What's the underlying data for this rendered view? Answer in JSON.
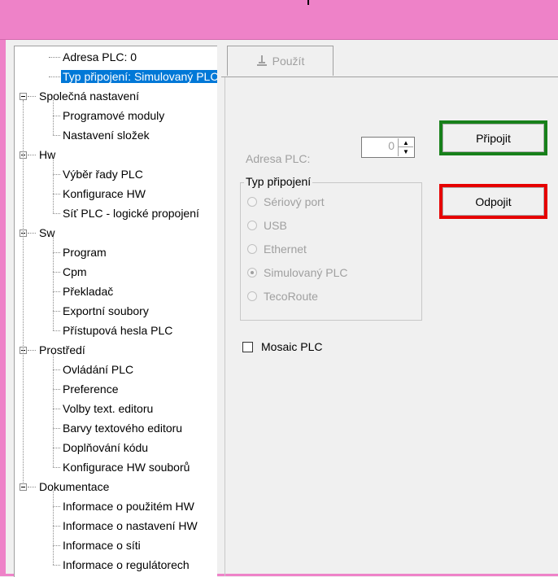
{
  "tree": {
    "items": [
      {
        "label": "Adresa PLC: 0",
        "level": 1,
        "selected": false
      },
      {
        "label": "Typ připojení: Simulovaný PLC",
        "level": 1,
        "selected": true
      },
      {
        "label": "Společná nastavení",
        "level": 0,
        "expanded": true
      },
      {
        "label": "Programové moduly",
        "level": 1
      },
      {
        "label": "Nastavení složek",
        "level": 1
      },
      {
        "label": "Hw",
        "level": 0,
        "expanded": true
      },
      {
        "label": "Výběr řady PLC",
        "level": 1
      },
      {
        "label": "Konfigurace HW",
        "level": 1
      },
      {
        "label": "Síť PLC - logické propojení",
        "level": 1
      },
      {
        "label": "Sw",
        "level": 0,
        "expanded": true
      },
      {
        "label": "Program",
        "level": 1
      },
      {
        "label": "Cpm",
        "level": 1
      },
      {
        "label": "Překladač",
        "level": 1
      },
      {
        "label": "Exportní soubory",
        "level": 1
      },
      {
        "label": "Přístupová hesla PLC",
        "level": 1
      },
      {
        "label": "Prostředí",
        "level": 0,
        "expanded": true
      },
      {
        "label": "Ovládání PLC",
        "level": 1
      },
      {
        "label": "Preference",
        "level": 1
      },
      {
        "label": "Volby text. editoru",
        "level": 1
      },
      {
        "label": "Barvy textového editoru",
        "level": 1
      },
      {
        "label": "Doplňování kódu",
        "level": 1
      },
      {
        "label": "Konfigurace HW souborů",
        "level": 1
      },
      {
        "label": "Dokumentace",
        "level": 0,
        "expanded": true
      },
      {
        "label": "Informace o použitém HW",
        "level": 1
      },
      {
        "label": "Informace o nastavení HW",
        "level": 1
      },
      {
        "label": "Informace o síti",
        "level": 1
      },
      {
        "label": "Informace o regulátorech",
        "level": 1
      }
    ]
  },
  "toolbar": {
    "apply_label": "Použít",
    "apply_icon": "apply-icon"
  },
  "form": {
    "address_label": "Adresa PLC:",
    "address_value": "0",
    "connection_group_label": "Typ připojení",
    "connection_options": [
      {
        "label": "Sériový port",
        "selected": false
      },
      {
        "label": "USB",
        "selected": false
      },
      {
        "label": "Ethernet",
        "selected": false
      },
      {
        "label": "Simulovaný PLC",
        "selected": true
      },
      {
        "label": "TecoRoute",
        "selected": false
      }
    ],
    "mosaic_label": "Mosaic PLC",
    "mosaic_checked": false
  },
  "actions": {
    "connect_label": "Připojit",
    "disconnect_label": "Odpojit",
    "connect_border_color": "#17801a",
    "disconnect_border_color": "#e60000"
  },
  "colors": {
    "titlebar": "#ee82c8",
    "selection": "#0078d7",
    "disabled_text": "#a0a0a0"
  }
}
